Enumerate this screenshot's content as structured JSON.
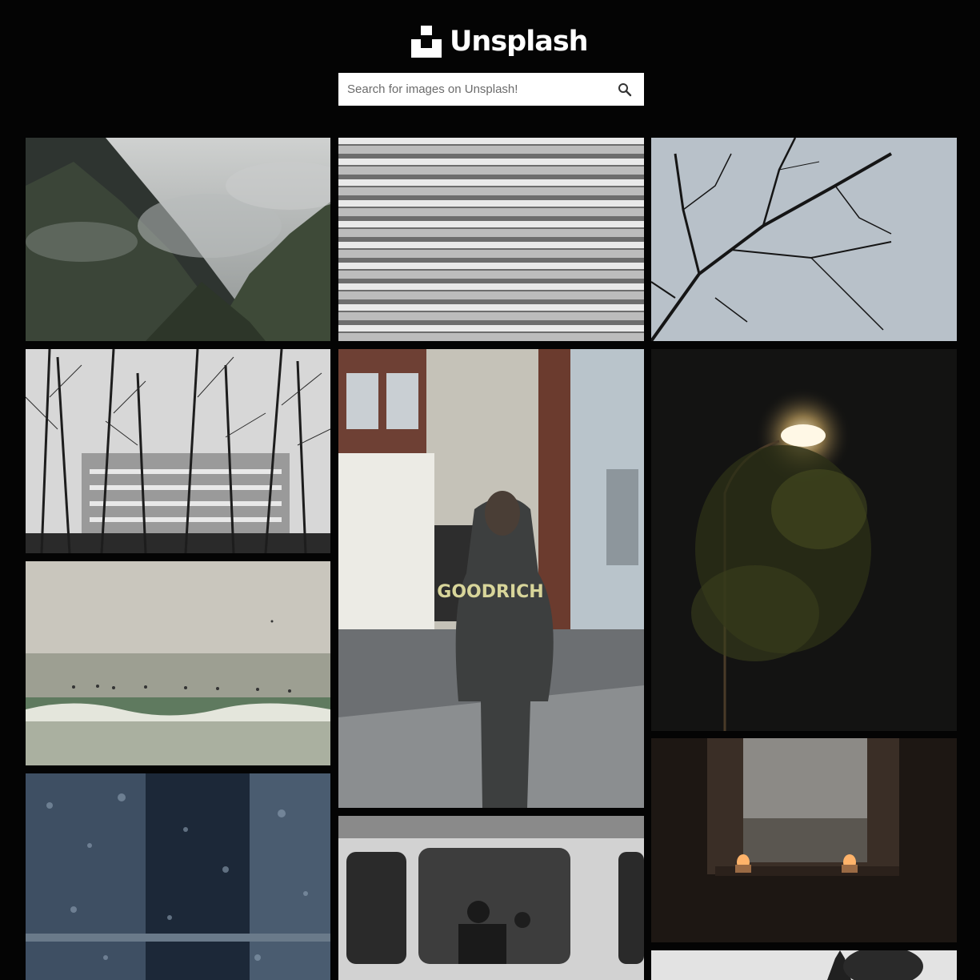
{
  "header": {
    "logo_text": "Unsplash"
  },
  "search": {
    "placeholder": "Search for images on Unsplash!",
    "value": ""
  },
  "gallery": {
    "photos": [
      {
        "name": "photo-misty-mountains",
        "icon": "photo-icon"
      },
      {
        "name": "photo-building-facade",
        "icon": "photo-icon"
      },
      {
        "name": "photo-bare-branches-sky",
        "icon": "photo-icon"
      },
      {
        "name": "photo-trees-before-building",
        "icon": "photo-icon"
      },
      {
        "name": "photo-hooded-man-street",
        "icon": "photo-icon"
      },
      {
        "name": "photo-street-lamp-night",
        "icon": "photo-icon"
      },
      {
        "name": "photo-sea-waves-birds",
        "icon": "photo-icon"
      },
      {
        "name": "photo-rainy-window-blue",
        "icon": "photo-icon"
      },
      {
        "name": "photo-bus-window-bw",
        "icon": "photo-icon"
      },
      {
        "name": "photo-window-candles",
        "icon": "photo-icon"
      },
      {
        "name": "photo-tree-silhouette",
        "icon": "photo-icon"
      }
    ],
    "hooded_shirt_text": "GOODRICH"
  },
  "colors": {
    "background": "#040404",
    "search_background": "#ffffff",
    "logo": "#ffffff"
  }
}
